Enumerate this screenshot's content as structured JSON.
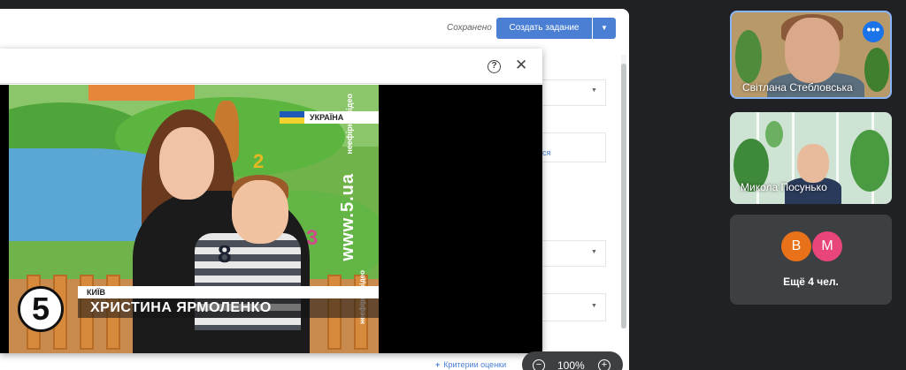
{
  "classroom": {
    "saved_status": "Сохранено",
    "create_button_label": "Создать задание",
    "partial_link_text": "ся",
    "rubric_link_label": "Критерии оценки"
  },
  "dialog": {
    "help_icon": "?",
    "close_icon": "✕"
  },
  "video": {
    "country_label": "УКРАЇНА",
    "channel_site": "www.5.ua",
    "watermark_small": "неефірне відео",
    "logo_number": "5",
    "city_caption": "КИЇВ",
    "name_caption": "ХРИСТИНА ЯРМОЛЕНКО",
    "decor_num2": "2",
    "decor_num3": "3",
    "shirt_num": "8"
  },
  "zoom": {
    "out_icon": "−",
    "value": "100%",
    "in_icon": "+"
  },
  "participants": {
    "tile1_name": "Світлана Стебловська",
    "tile1_more_icon": "•••",
    "tile2_name": "Микола Посунько",
    "avatar1_letter": "В",
    "avatar1_color": "#e8711a",
    "avatar2_letter": "М",
    "avatar2_color": "#e8457a",
    "more_count_label": "Ещё 4 чел."
  }
}
